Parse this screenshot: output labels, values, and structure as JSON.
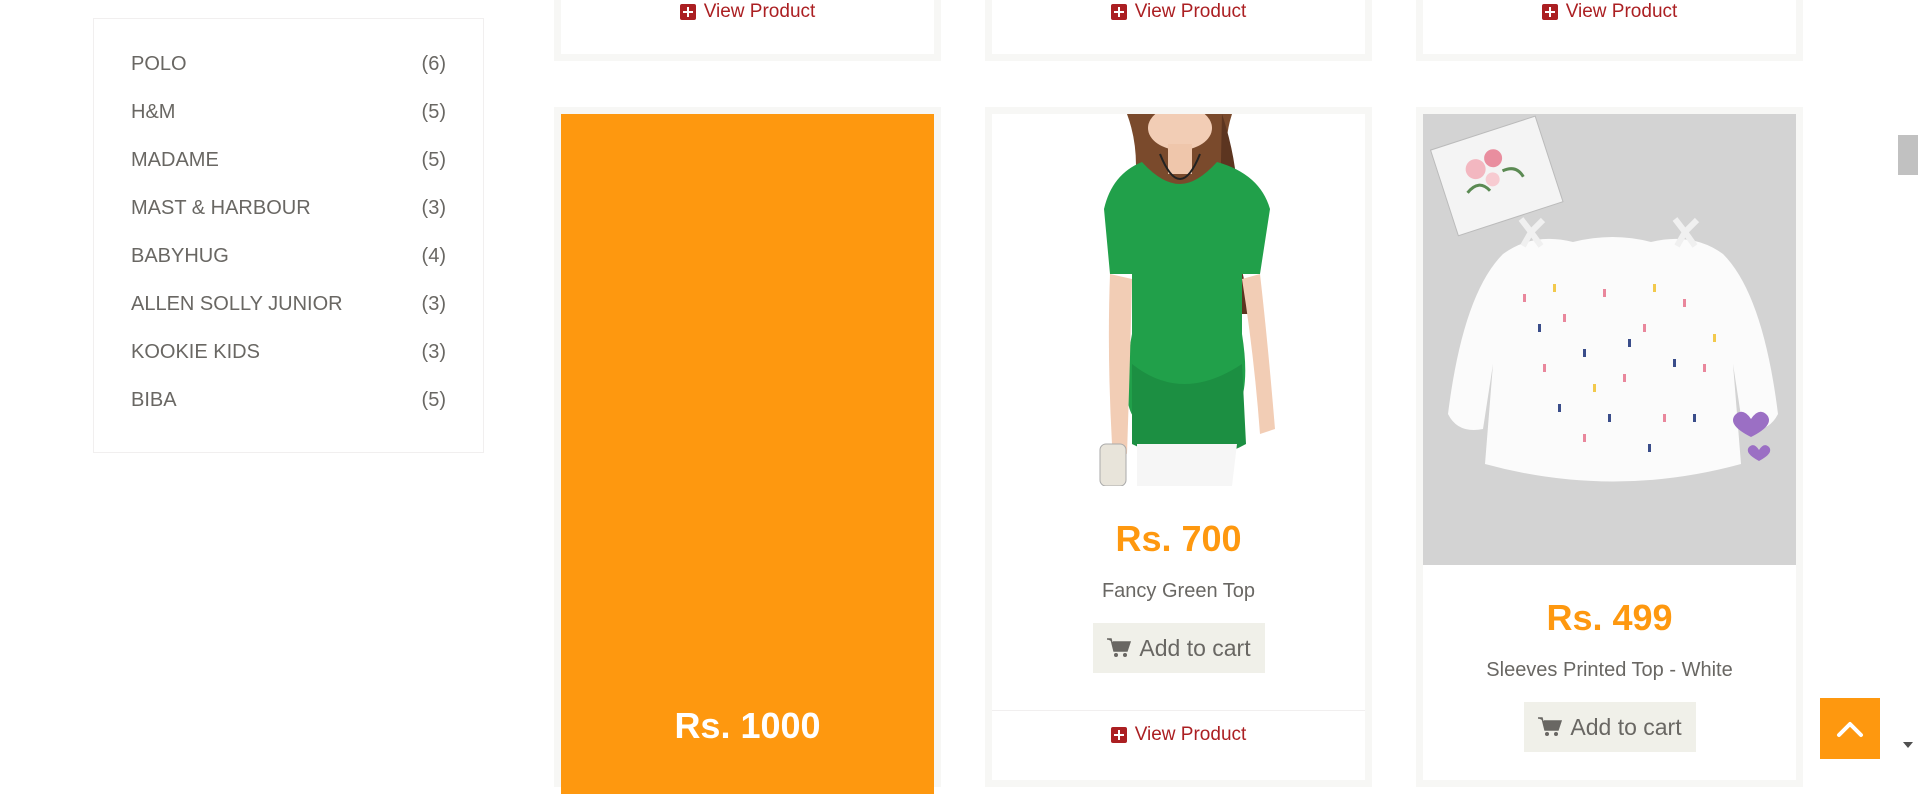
{
  "brands": [
    {
      "name": "POLO",
      "count": "(6)"
    },
    {
      "name": "H&M",
      "count": "(5)"
    },
    {
      "name": "MADAME",
      "count": "(5)"
    },
    {
      "name": "MAST & HARBOUR",
      "count": "(3)"
    },
    {
      "name": "BABYHUG",
      "count": "(4)"
    },
    {
      "name": "ALLEN SOLLY JUNIOR",
      "count": "(3)"
    },
    {
      "name": "KOOKIE KIDS",
      "count": "(3)"
    },
    {
      "name": "BIBA",
      "count": "(5)"
    }
  ],
  "view_product_label": "View Product",
  "add_to_cart_label": "Add to cart",
  "products": [
    {
      "price": "Rs. 1000",
      "name": ""
    },
    {
      "price": "Rs. 700",
      "name": "Fancy Green Top"
    },
    {
      "price": "Rs. 499",
      "name": "Sleeves Printed Top - White"
    }
  ],
  "colors": {
    "accent_orange": "#fe980f",
    "link_red": "#ab1f22",
    "text_gray": "#696763",
    "button_bg": "#f0f0e9"
  },
  "icons": [
    "plus-square-icon",
    "shopping-cart-icon",
    "chevron-up-icon"
  ]
}
